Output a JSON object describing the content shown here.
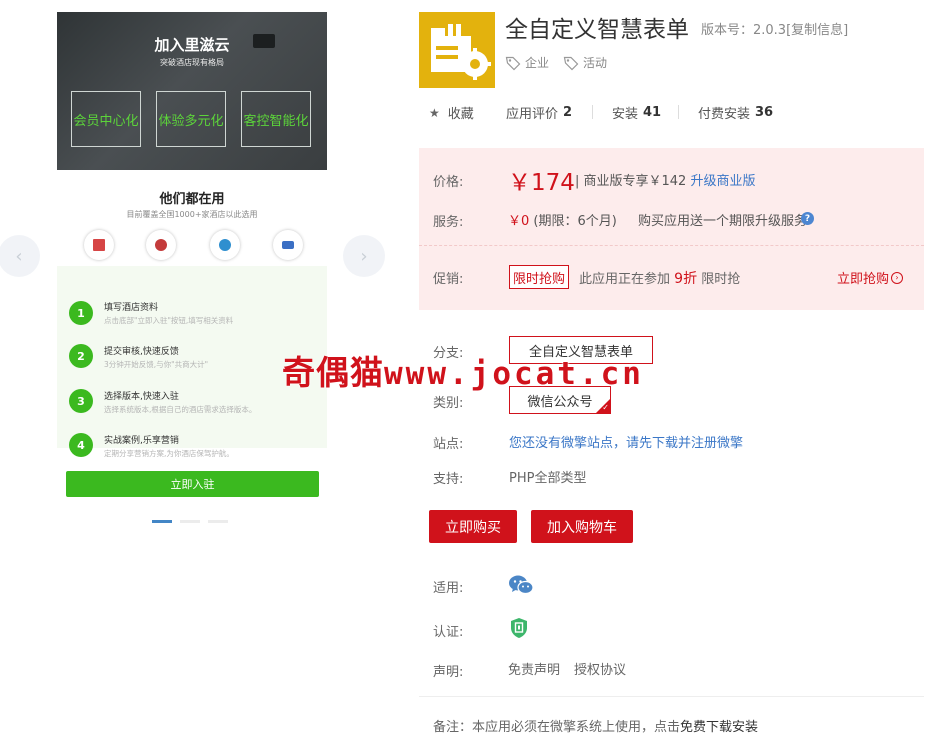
{
  "gallery": {
    "hero": {
      "title": "加入里滋云",
      "subtitle": "突破酒店现有格局",
      "boxes": [
        "会员中心化",
        "体验多元化",
        "客控智能化"
      ]
    },
    "partners": {
      "title": "他们都在用",
      "subtitle": "目前覆盖全国1000+家酒店以此选用"
    },
    "steps": [
      {
        "num": "1",
        "title": "填写酒店资料",
        "desc": "点击底部\"立即入驻\"按钮,填写相关资料"
      },
      {
        "num": "2",
        "title": "提交审核,快速反馈",
        "desc": "3分钟开始反馈,与你\"共商大计\""
      },
      {
        "num": "3",
        "title": "选择版本,快速入驻",
        "desc": "选择系统版本,根据自己的酒店需求选择版本。"
      },
      {
        "num": "4",
        "title": "实战案例,乐享营销",
        "desc": "定期分享营销方案,为你酒店保驾护航。"
      }
    ],
    "join_button": "立即入驻",
    "prev_arrow": "‹",
    "next_arrow": "›"
  },
  "app": {
    "title": "全自定义智慧表单",
    "version": "版本号：2.0.3[复制信息]",
    "tags": [
      "企业",
      "活动"
    ],
    "icon": "form-gear-icon",
    "icon_color": "#e3b20d"
  },
  "stats": {
    "favorite_label": "收藏",
    "rating_label": "应用评价",
    "rating_value": "2",
    "install_label": "安装",
    "install_value": "41",
    "paid_label": "付费安装",
    "paid_value": "36"
  },
  "pricing": {
    "price_label": "价格:",
    "price": "￥174",
    "business_text": "| 商业版专享￥142",
    "upgrade_link": "升级商业版",
    "service_label": "服务:",
    "service_price": "￥0",
    "service_period": "(期限：6个月)",
    "service_desc": "购买应用送一个期限升级服务",
    "service_help": "?",
    "promo_label": "促销:",
    "promo_tag": "限时抢购",
    "promo_prefix": "此应用正在参加",
    "promo_discount": "9折",
    "promo_suffix": "限时抢",
    "promo_link": "立即抢购",
    "promo_link_icon": "›"
  },
  "details": {
    "branch_label": "分支:",
    "branch_option": "全自定义智慧表单",
    "category_label": "类别:",
    "category_option": "微信公众号",
    "site_label": "站点:",
    "site_text": "您还没有微擎站点，请先下载并注册微擎",
    "support_label": "支持:",
    "support_text": "PHP全部类型"
  },
  "actions": {
    "buy_now": "立即购买",
    "add_cart": "加入购物车"
  },
  "meta": {
    "apply_label": "适用:",
    "cert_label": "认证:",
    "decl_label": "声明:",
    "disclaimer": "免责声明",
    "license": "授权协议",
    "note_prefix": "备注：本应用必须在微擎系统上使用，点击",
    "note_link": "免费下载安装"
  },
  "watermark": {
    "cn": "奇偶猫",
    "latin": "www.jocat.cn"
  },
  "colors": {
    "accent_red": "#d0121b",
    "link_blue": "#3b77c7",
    "green": "#3bb91f",
    "price_panel_bg": "#fdecec"
  }
}
